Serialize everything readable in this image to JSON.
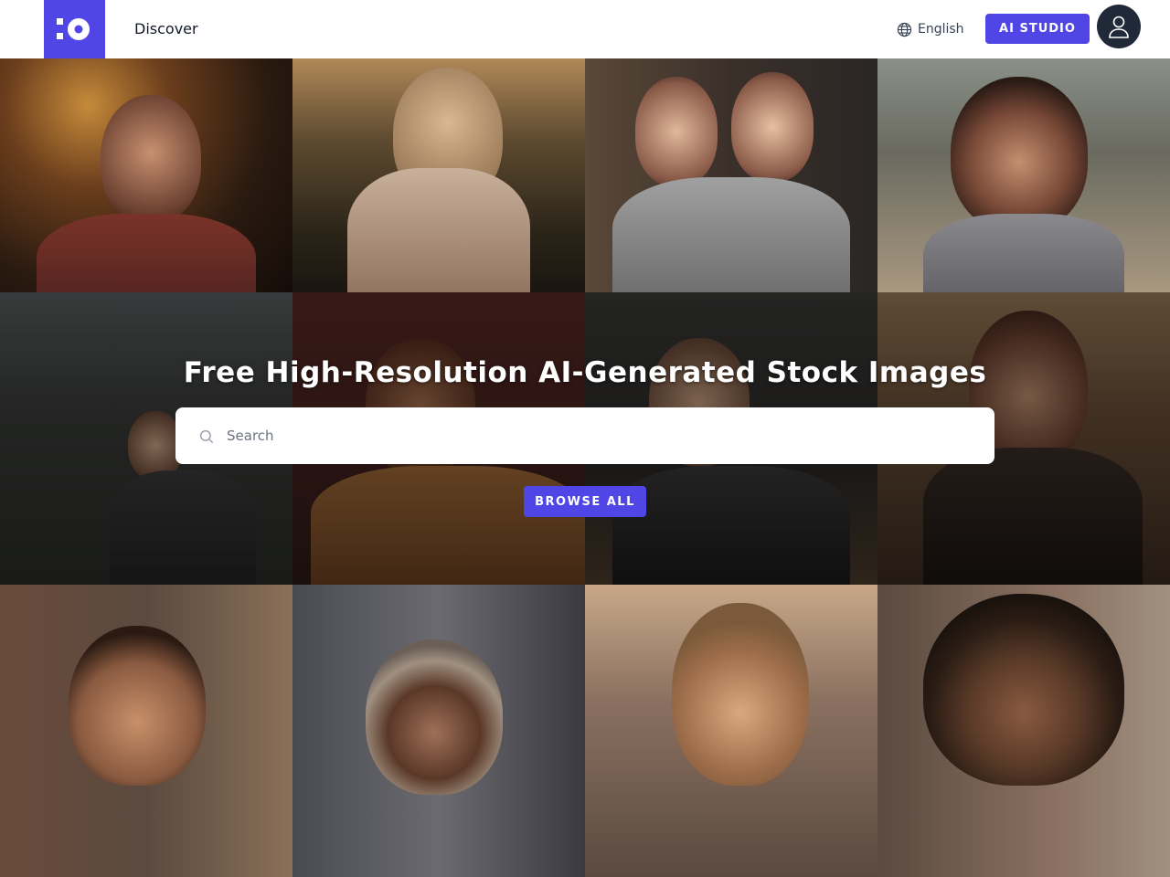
{
  "header": {
    "nav_discover": "Discover",
    "language": "English",
    "ai_studio_label": "AI STUDIO"
  },
  "hero": {
    "title": "Free High-Resolution AI-Generated Stock Images",
    "search_placeholder": "Search",
    "browse_label": "BROWSE ALL"
  },
  "colors": {
    "accent": "#4f46e5",
    "avatar_bg": "#1f2937"
  },
  "icons": {
    "logo": "brand-logo-icon",
    "language": "globe-icon",
    "user": "user-icon",
    "search": "search-icon"
  }
}
